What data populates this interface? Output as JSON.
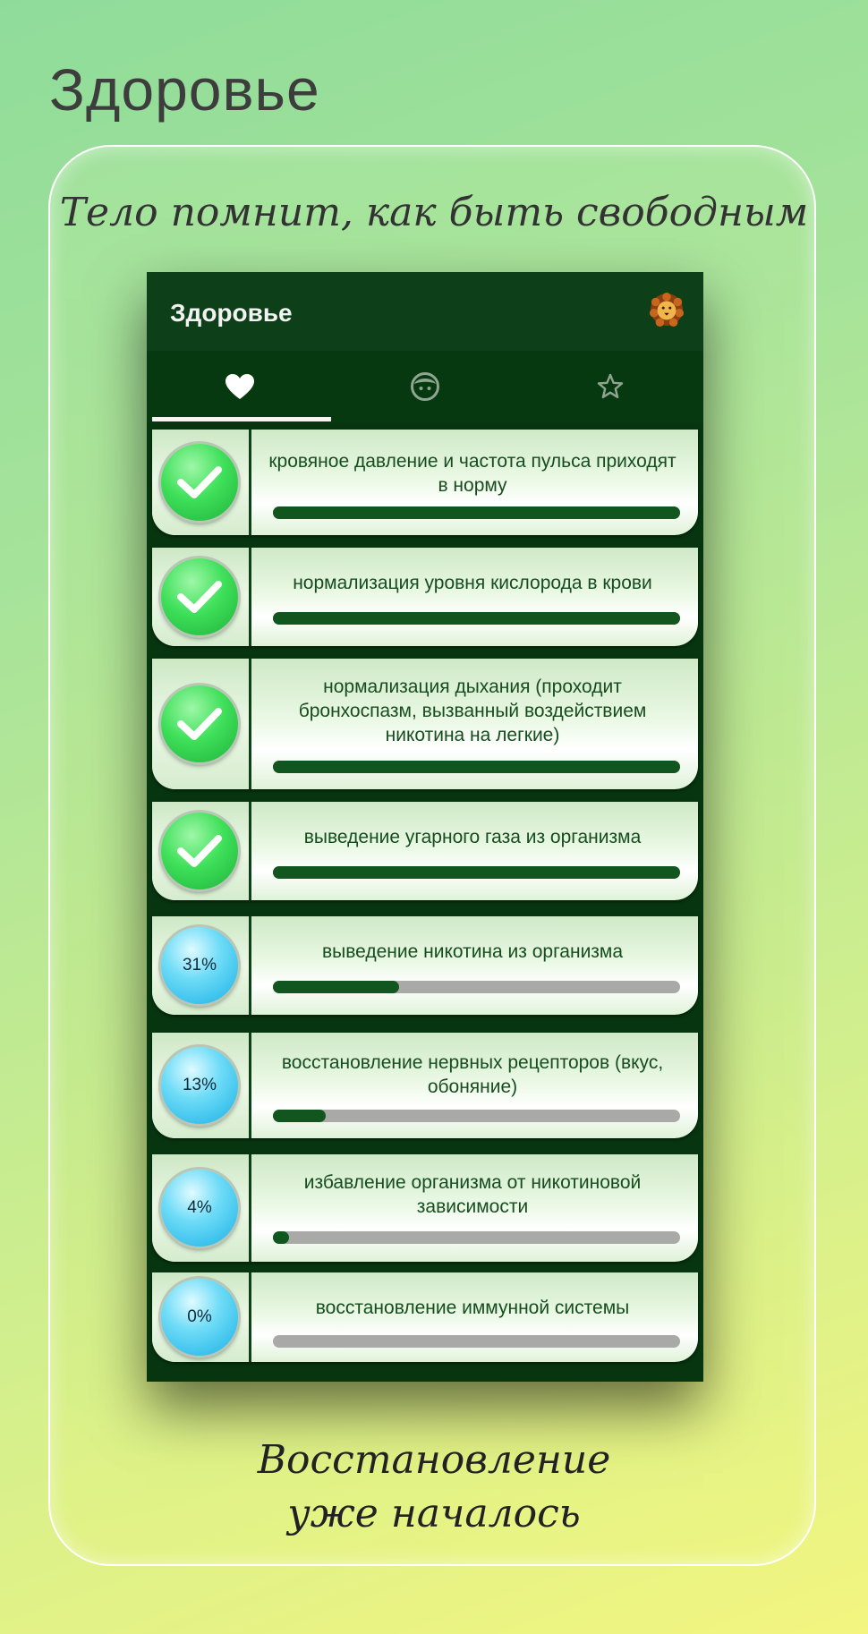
{
  "page_heading": "Здоровье",
  "tagline": "Тело помнит, как быть свободным",
  "footer": {
    "line1": "Восстановление",
    "line2": "уже началось"
  },
  "app": {
    "title": "Здоровье",
    "avatar_icon": "lion-icon",
    "tabs": [
      {
        "icon": "heart-icon",
        "selected": true
      },
      {
        "icon": "face-icon",
        "selected": false
      },
      {
        "icon": "star-icon",
        "selected": false
      }
    ]
  },
  "colors": {
    "app_bar": "#0d3f18",
    "progress_fill": "#11561f",
    "progress_track": "#a9aaa8",
    "done_badge": "#3fe05a",
    "progress_badge": "#19b0e6"
  },
  "items": [
    {
      "text": "кровяное давление и частота пульса приходят в норму",
      "done": true,
      "progress": 100
    },
    {
      "text": "нормализация уровня кислорода в крови",
      "done": true,
      "progress": 100
    },
    {
      "text": "нормализация дыхания (проходит бронхоспазм, вызванный воздействием никотина на легкие)",
      "done": true,
      "progress": 100
    },
    {
      "text": "выведение угарного газа из организма",
      "done": true,
      "progress": 100
    },
    {
      "text": "выведение никотина из организма",
      "done": false,
      "percent_label": "31%",
      "progress": 31
    },
    {
      "text": "восстановление нервных рецепторов (вкус, обоняние)",
      "done": false,
      "percent_label": "13%",
      "progress": 13
    },
    {
      "text": "избавление организма от никотиновой зависимости",
      "done": false,
      "percent_label": "4%",
      "progress": 4
    },
    {
      "text": "восстановление иммунной системы",
      "done": false,
      "percent_label": "0%",
      "progress": 0
    }
  ]
}
